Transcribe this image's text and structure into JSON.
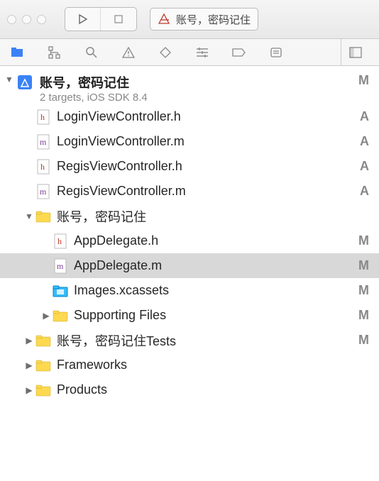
{
  "toolbar": {
    "scheme_text": "账号，密码记住"
  },
  "project": {
    "name": "账号，密码记住",
    "subtitle": "2 targets, iOS SDK 8.4",
    "badge": "M"
  },
  "rows": [
    {
      "icon": "h",
      "label": "LoginViewController.h",
      "badge": "A",
      "indent": 1,
      "disclosure": "none"
    },
    {
      "icon": "m",
      "label": "LoginViewController.m",
      "badge": "A",
      "indent": 1,
      "disclosure": "none"
    },
    {
      "icon": "h",
      "label": "RegisViewController.h",
      "badge": "A",
      "indent": 1,
      "disclosure": "none"
    },
    {
      "icon": "m",
      "label": "RegisViewController.m",
      "badge": "A",
      "indent": 1,
      "disclosure": "none"
    },
    {
      "icon": "folder",
      "label": "账号，密码记住",
      "badge": "",
      "indent": 1,
      "disclosure": "open"
    },
    {
      "icon": "h",
      "label": "AppDelegate.h",
      "badge": "M",
      "indent": 2,
      "disclosure": "none"
    },
    {
      "icon": "m",
      "label": "AppDelegate.m",
      "badge": "M",
      "indent": 2,
      "disclosure": "none",
      "selected": true
    },
    {
      "icon": "assets",
      "label": "Images.xcassets",
      "badge": "M",
      "indent": 2,
      "disclosure": "none"
    },
    {
      "icon": "folder",
      "label": "Supporting Files",
      "badge": "M",
      "indent": 2,
      "disclosure": "closed"
    },
    {
      "icon": "folder",
      "label": "账号，密码记住Tests",
      "badge": "M",
      "indent": 1,
      "disclosure": "closed"
    },
    {
      "icon": "folder",
      "label": "Frameworks",
      "badge": "",
      "indent": 1,
      "disclosure": "closed"
    },
    {
      "icon": "folder",
      "label": "Products",
      "badge": "",
      "indent": 1,
      "disclosure": "closed"
    }
  ]
}
